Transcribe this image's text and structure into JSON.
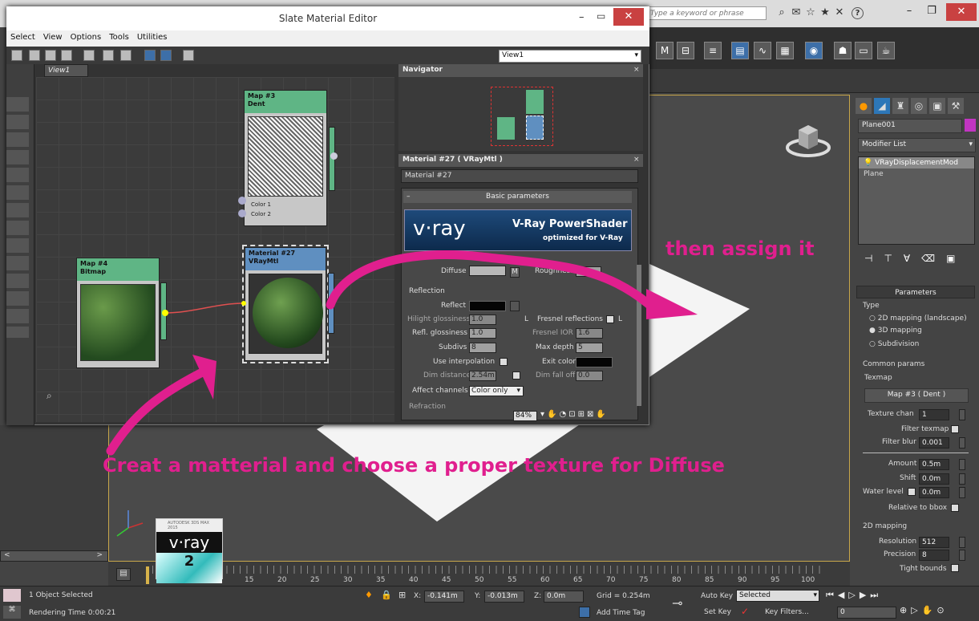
{
  "app": {
    "search_placeholder": "Type a keyword or phrase",
    "help_label": "?"
  },
  "slate": {
    "title": "Slate Material Editor",
    "menu": [
      "Select",
      "View",
      "Options",
      "Tools",
      "Utilities"
    ],
    "view_dropdown": "View1",
    "view_tab": "View1",
    "navigator_title": "Navigator",
    "material_panel_title": "Material #27  ( VRayMtl )",
    "material_name": "Material #27",
    "basic_params": "Basic parameters",
    "banner_title": "V-Ray PowerShader",
    "banner_sub": "optimized for V-Ray",
    "banner_logo": "v·ray",
    "zoom": "84%",
    "nodes": {
      "map3_title": "Map #3",
      "map3_sub": "Dent",
      "map3_slot1": "Color 1",
      "map3_slot2": "Color 2",
      "map4_title": "Map #4",
      "map4_sub": "Bitmap",
      "mat27_title": "Material #27",
      "mat27_sub": "VRayMtl"
    },
    "diffuse": {
      "group": "Diffuse",
      "diffuse_label": "Diffuse",
      "map_btn": "M",
      "roughness_label": "Roughness",
      "roughness_value": "0.0"
    },
    "reflection": {
      "group": "Reflection",
      "reflect_label": "Reflect",
      "hilight_label": "Hilight glossiness",
      "hilight_value": "1.0",
      "lock_label": "L",
      "fresnel_label": "Fresnel reflections",
      "refl_gloss_label": "Refl. glossiness",
      "refl_gloss_value": "1.0",
      "fresnel_ior_label": "Fresnel IOR",
      "fresnel_ior_value": "1.6",
      "subdivs_label": "Subdivs",
      "subdivs_value": "8",
      "max_depth_label": "Max depth",
      "max_depth_value": "5",
      "use_interp_label": "Use interpolation",
      "exit_color_label": "Exit color",
      "dim_dist_label": "Dim distance",
      "dim_dist_value": "2.54m",
      "dim_falloff_label": "Dim fall off",
      "dim_falloff_value": "0.0",
      "affect_label": "Affect channels",
      "affect_value": "Color only",
      "refraction_group": "Refraction"
    }
  },
  "cmd": {
    "object_name": "Plane001",
    "modifier_list": "Modifier List",
    "stack": [
      "VRayDisplacementMod",
      "Plane"
    ],
    "params_header": "Parameters",
    "type_label": "Type",
    "type_options": [
      "2D mapping (landscape)",
      "3D mapping",
      "Subdivision"
    ],
    "common_label": "Common params",
    "texmap_label": "Texmap",
    "texmap_btn": "Map #3  ( Dent )",
    "texture_chan_label": "Texture chan",
    "texture_chan_value": "1",
    "filter_texmap_label": "Filter texmap",
    "filter_blur_label": "Filter blur",
    "filter_blur_value": "0.001",
    "amount_label": "Amount",
    "amount_value": "0.5m",
    "shift_label": "Shift",
    "shift_value": "0.0m",
    "water_label": "Water level",
    "water_value": "0.0m",
    "relative_label": "Relative to bbox",
    "mapping2d_label": "2D mapping",
    "resolution_label": "Resolution",
    "resolution_value": "512",
    "precision_label": "Precision",
    "precision_value": "8",
    "tight_label": "Tight bounds"
  },
  "timeline": {
    "ticks": [
      "15",
      "20",
      "25",
      "30",
      "35",
      "40",
      "45",
      "50",
      "55",
      "60",
      "65",
      "70",
      "75",
      "80",
      "85",
      "90",
      "95",
      "100"
    ]
  },
  "status": {
    "selected": "1 Object Selected",
    "render_time": "Rendering Time  0:00:21",
    "x_label": "X:",
    "x_value": "-0.141m",
    "y_label": "Y:",
    "y_value": "-0.013m",
    "z_label": "Z:",
    "z_value": "0.0m",
    "grid": "Grid = 0.254m",
    "add_time_tag": "Add Time Tag",
    "auto_key": "Auto Key",
    "selected_dropdown": "Selected",
    "set_key": "Set Key",
    "key_filters": "Key Filters...",
    "frame_value": "0"
  },
  "thumbnail": {
    "brand": "AUTODESK 3DS MAX 2015",
    "logo": "v·ray",
    "number": "2"
  },
  "annotations": {
    "assign": "then assign it",
    "create": "Creat a matterial and choose a proper texture for Diffuse"
  },
  "colors": {
    "annotation": "#e01f8e",
    "node_header": "#5fb585",
    "node_header_mat": "#5f8fc0"
  }
}
